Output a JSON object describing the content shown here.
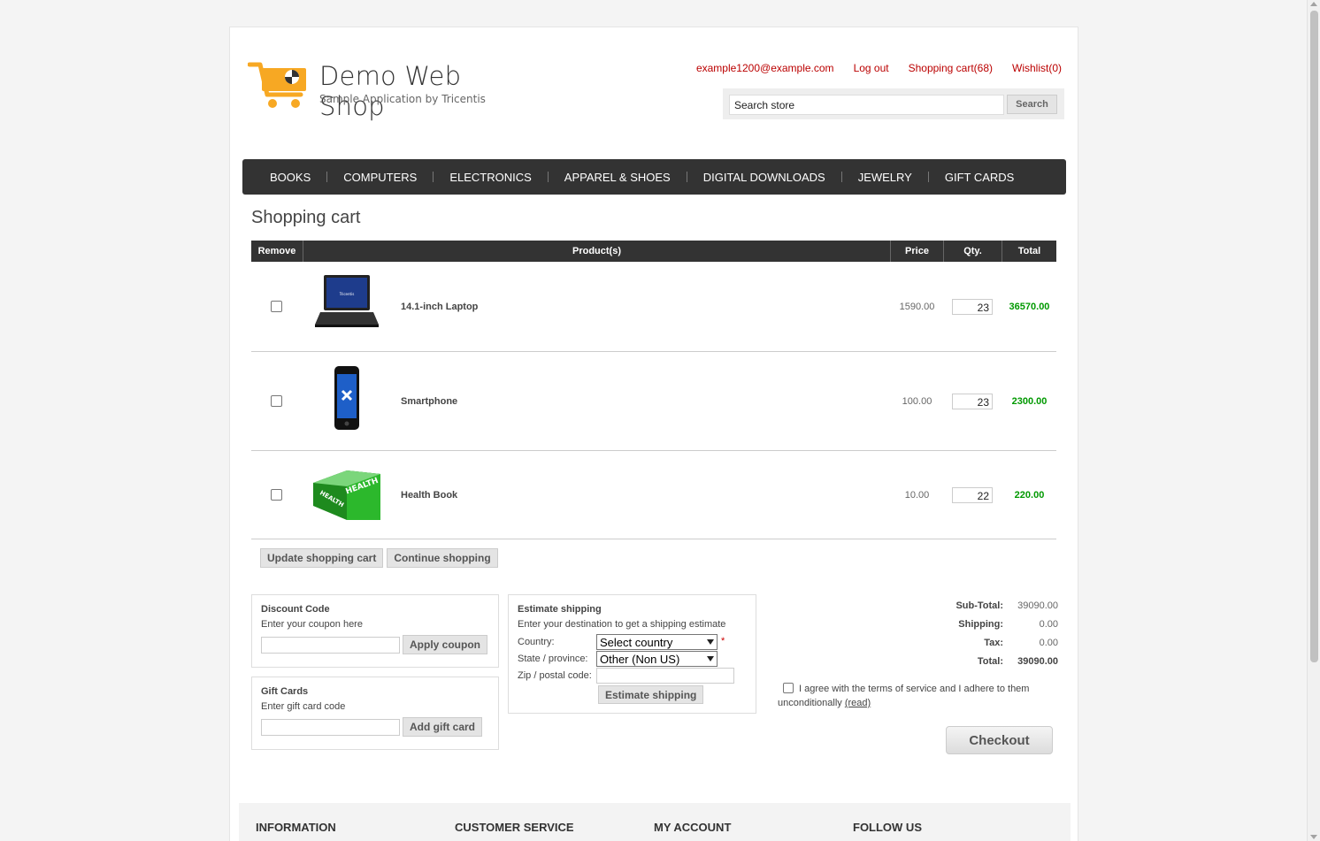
{
  "header": {
    "logo_title": "Demo Web Shop",
    "logo_subtitle": "Sample Application by Tricentis",
    "links": [
      "example1200@example.com",
      "Log out",
      "Shopping cart(68)",
      "Wishlist(0)"
    ],
    "search_value": "Search store",
    "search_button": "Search"
  },
  "menu": [
    "BOOKS",
    "COMPUTERS",
    "ELECTRONICS",
    "APPAREL & SHOES",
    "DIGITAL DOWNLOADS",
    "JEWELRY",
    "GIFT CARDS"
  ],
  "page_title": "Shopping cart",
  "cart": {
    "columns": [
      "Remove",
      "Product(s)",
      "Price",
      "Qty.",
      "Total"
    ],
    "items": [
      {
        "name": "14.1-inch Laptop",
        "price": "1590.00",
        "qty": "23",
        "total": "36570.00",
        "image": "laptop"
      },
      {
        "name": "Smartphone",
        "price": "100.00",
        "qty": "23",
        "total": "2300.00",
        "image": "smartphone"
      },
      {
        "name": "Health Book",
        "price": "10.00",
        "qty": "22",
        "total": "220.00",
        "image": "book"
      }
    ],
    "update_button": "Update shopping cart",
    "continue_button": "Continue shopping"
  },
  "discount": {
    "title": "Discount Code",
    "hint": "Enter your coupon here",
    "button": "Apply coupon"
  },
  "giftcard": {
    "title": "Gift Cards",
    "hint": "Enter gift card code",
    "button": "Add gift card"
  },
  "shipping": {
    "title": "Estimate shipping",
    "hint": "Enter your destination to get a shipping estimate",
    "country_label": "Country:",
    "country_value": "Select country",
    "required_mark": "*",
    "state_label": "State / province:",
    "state_value": "Other (Non US)",
    "zip_label": "Zip / postal code:",
    "button": "Estimate shipping"
  },
  "totals": {
    "subtotal_label": "Sub-Total:",
    "subtotal": "39090.00",
    "shipping_label": "Shipping:",
    "shipping": "0.00",
    "tax_label": "Tax:",
    "tax": "0.00",
    "total_label": "Total:",
    "total": "39090.00"
  },
  "terms": {
    "text": "I agree with the terms of service and I adhere to them unconditionally",
    "read": "(read)"
  },
  "checkout_button": "Checkout",
  "footer": [
    "INFORMATION",
    "CUSTOMER SERVICE",
    "MY ACCOUNT",
    "FOLLOW US"
  ],
  "colors": {
    "link": "#bb0000",
    "menu_bg": "#333333",
    "total_green": "#009900",
    "logo_orange": "#f7a823"
  }
}
